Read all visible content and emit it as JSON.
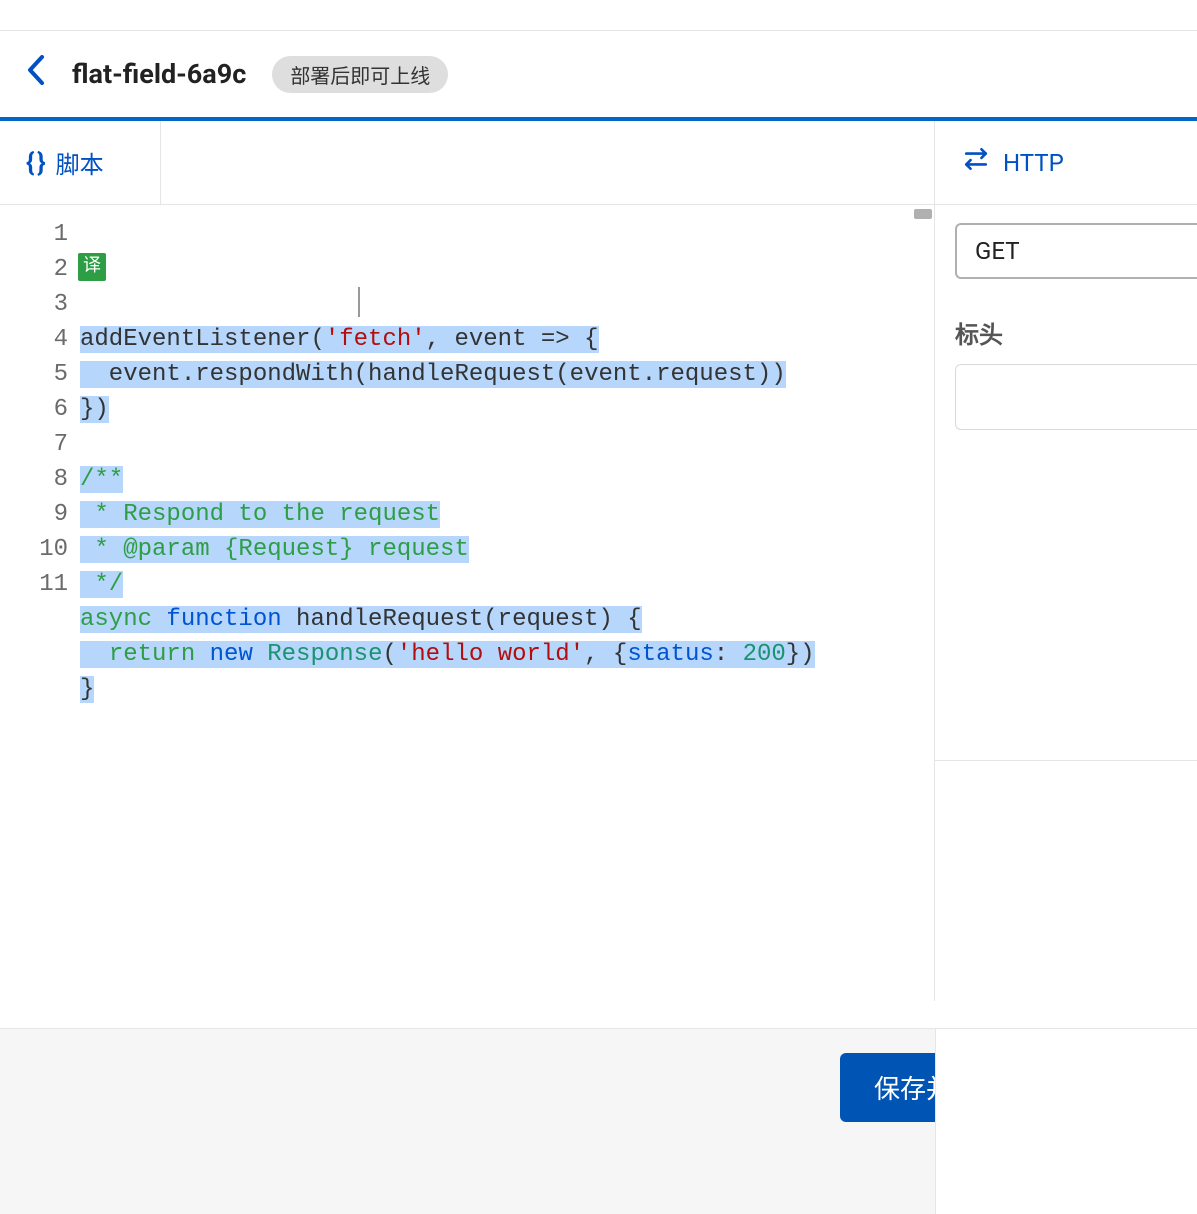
{
  "header": {
    "worker_name": "flat-field-6a9c",
    "status_badge": "部署后即可上线"
  },
  "tabs": {
    "script_label": "脚本",
    "http_label": "HTTP"
  },
  "editor": {
    "translate_badge": "译",
    "line_numbers": [
      "1",
      "2",
      "3",
      "4",
      "5",
      "6",
      "7",
      "8",
      "9",
      "10",
      "11"
    ],
    "code_tokens": [
      [
        {
          "t": "addEventListener(",
          "c": "",
          "sel": true
        },
        {
          "t": "'fetch'",
          "c": "tok-str",
          "sel": true
        },
        {
          "t": ", event => {",
          "c": "",
          "sel": true
        }
      ],
      [
        {
          "t": "  event.respondWith(handleRequest(event.request))",
          "c": "",
          "sel": true
        }
      ],
      [
        {
          "t": "})",
          "c": "",
          "sel": true
        }
      ],
      [
        {
          "t": "",
          "c": "",
          "sel": false
        }
      ],
      [
        {
          "t": "/**",
          "c": "tok-comment",
          "sel": true
        }
      ],
      [
        {
          "t": " * Respond to the request",
          "c": "tok-comment",
          "sel": true
        }
      ],
      [
        {
          "t": " * @param {Request} request",
          "c": "tok-comment",
          "sel": true
        }
      ],
      [
        {
          "t": " */",
          "c": "tok-comment",
          "sel": true
        }
      ],
      [
        {
          "t": "async ",
          "c": "tok-kw",
          "sel": true
        },
        {
          "t": "function ",
          "c": "tok-kw2",
          "sel": true
        },
        {
          "t": "handleRequest(request) {",
          "c": "",
          "sel": true
        }
      ],
      [
        {
          "t": "  ",
          "c": "",
          "sel": true
        },
        {
          "t": "return ",
          "c": "tok-kw",
          "sel": true
        },
        {
          "t": "new ",
          "c": "tok-kw2",
          "sel": true
        },
        {
          "t": "Response",
          "c": "tok-type",
          "sel": true
        },
        {
          "t": "(",
          "c": "",
          "sel": true
        },
        {
          "t": "'hello world'",
          "c": "tok-str",
          "sel": true
        },
        {
          "t": ", {",
          "c": "",
          "sel": true
        },
        {
          "t": "status",
          "c": "tok-prop",
          "sel": true
        },
        {
          "t": ": ",
          "c": "",
          "sel": true
        },
        {
          "t": "200",
          "c": "tok-num",
          "sel": true
        },
        {
          "t": "})",
          "c": "",
          "sel": true
        }
      ],
      [
        {
          "t": "}",
          "c": "",
          "sel": true
        }
      ]
    ]
  },
  "http_panel": {
    "method": "GET",
    "headers_label": "标头"
  },
  "footer": {
    "deploy_button": "保存并部署"
  }
}
